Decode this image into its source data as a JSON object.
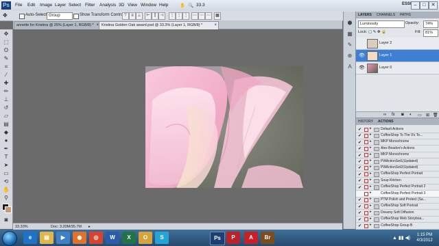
{
  "app": {
    "logo": "Ps",
    "menu": [
      "File",
      "Edit",
      "Image",
      "Layer",
      "Select",
      "Filter",
      "Analysis",
      "3D",
      "View",
      "Window",
      "Help"
    ],
    "zoom_indicator": "33.3",
    "workspace": "ESSENTIALS",
    "window_buttons": [
      "–",
      "□",
      "✕"
    ]
  },
  "options_bar": {
    "auto_select_label": "Auto-Select:",
    "auto_select_value": "Group",
    "show_transform_label": "Show Transform Controls"
  },
  "document_tabs": [
    {
      "label": "annette for Kristina @ 25% (Layer 1, RGB/8) *",
      "active": false
    },
    {
      "label": "Kristina Golden Oak award.psd @ 33.3% (Layer 1, RGB/8) *",
      "active": true
    }
  ],
  "status_bar": {
    "zoom": "33.33%",
    "doc_size": "Doc: 3.20M/35.7M"
  },
  "layers_panel": {
    "tabs": [
      "LAYERS",
      "CHANNELS",
      "PATHS"
    ],
    "blend_mode": "Luminosity",
    "opacity_label": "Opacity:",
    "opacity_value": "74%",
    "lock_label": "Lock:",
    "fill_label": "Fill:",
    "fill_value": "81%",
    "layers": [
      {
        "name": "Layer 2",
        "selected": false,
        "visible": false
      },
      {
        "name": "Layer 1",
        "selected": true,
        "visible": true
      },
      {
        "name": "Layer 0",
        "selected": false,
        "visible": true
      }
    ]
  },
  "actions_panel": {
    "tabs": [
      "HISTORY",
      "ACTIONS"
    ],
    "items": [
      {
        "name": "Default Actions",
        "sub": false
      },
      {
        "name": "CoffeeShop To The 9's To...",
        "sub": false
      },
      {
        "name": "MKP Monochrome",
        "sub": false
      },
      {
        "name": "Alex Beadon's Actions",
        "sub": false
      },
      {
        "name": "MKP Monochrome",
        "sub": false
      },
      {
        "name": "PWActionSet1(Updated)",
        "sub": false
      },
      {
        "name": "PWActionSet2(Updated)",
        "sub": false
      },
      {
        "name": "CoffeeShop Perfect Portrait",
        "sub": false
      },
      {
        "name": "Soup Kitchen",
        "sub": false
      },
      {
        "name": "CoffeeShop Perfect Portrait 2",
        "sub": false
      },
      {
        "name": "CoffeeShop Perfect Portrait 3",
        "sub": true
      },
      {
        "name": "PTM Polish and Protect (Sa...",
        "sub": false
      },
      {
        "name": "CoffeeShop Soft Portrait",
        "sub": false
      },
      {
        "name": "Dreamy Soft Diffusion",
        "sub": false
      },
      {
        "name": "CoffeeShop Web Storyboa...",
        "sub": false
      },
      {
        "name": "CoffeeShop Group B",
        "sub": false
      }
    ]
  },
  "taskbar": {
    "time": "1:15 PM",
    "date": "4/3/2012",
    "apps": [
      "IE",
      "Folder",
      "Media",
      "Firefox",
      "Chrome",
      "Word",
      "Excel",
      "Outlook",
      "Skype",
      "Ps",
      "PDF",
      "Acrobat",
      "Bridge"
    ]
  }
}
